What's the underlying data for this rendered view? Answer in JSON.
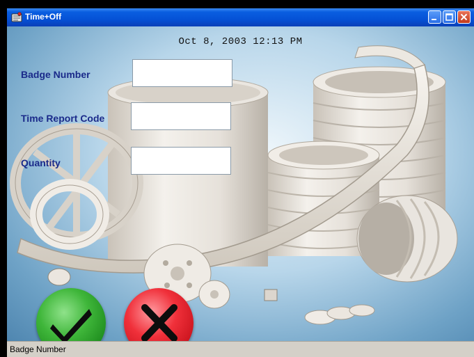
{
  "window": {
    "title": "Time+Off"
  },
  "datetime": "Oct  8, 2003 12:13 PM",
  "form": {
    "badge_number": {
      "label": "Badge Number",
      "value": ""
    },
    "time_report_code": {
      "label": "Time Report Code",
      "value": ""
    },
    "quantity": {
      "label": "Quantity",
      "value": ""
    }
  },
  "buttons": {
    "ok_icon": "checkmark-icon",
    "cancel_icon": "x-icon"
  },
  "status": {
    "text": "Badge Number"
  },
  "colors": {
    "titlebar": "#0552d6",
    "label_text": "#1a2a8a",
    "ok_button": "#3fb63a",
    "cancel_button": "#f0303a",
    "statusbar": "#d4d0c8"
  }
}
